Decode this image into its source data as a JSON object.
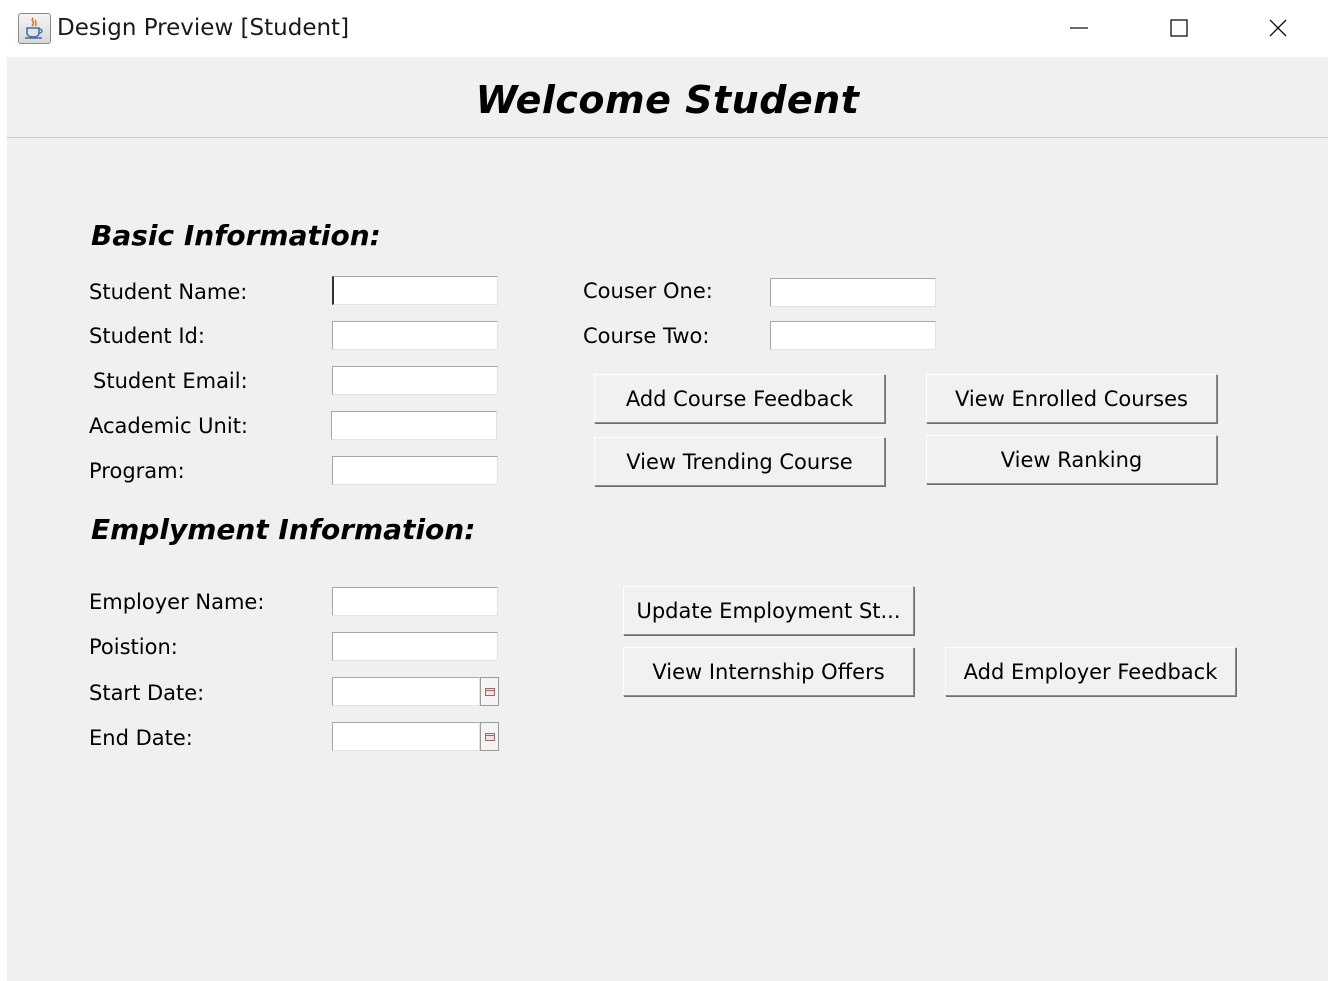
{
  "window": {
    "title": "Design Preview [Student]",
    "icon": "java-cup-icon",
    "controls": [
      "minimize-icon",
      "maximize-icon",
      "close-icon"
    ]
  },
  "heading": "Welcome Student",
  "basic_info": {
    "title": "Basic Information:",
    "fields": [
      {
        "label": "Student Name:",
        "value": ""
      },
      {
        "label": "Student Id:",
        "value": ""
      },
      {
        "label": "Student Email:",
        "value": ""
      },
      {
        "label": "Academic Unit:",
        "value": ""
      },
      {
        "label": "Program:",
        "value": ""
      }
    ],
    "courses": [
      {
        "label": "Couser One:",
        "value": ""
      },
      {
        "label": "Course Two:",
        "value": ""
      }
    ],
    "buttons": {
      "add_course_feedback": "Add Course Feedback",
      "view_enrolled_courses": "View Enrolled Courses",
      "view_trending_course": "View Trending Course",
      "view_ranking": "View Ranking"
    }
  },
  "employment_info": {
    "title": "Emplyment Information:",
    "fields": [
      {
        "label": "Employer Name:",
        "value": ""
      },
      {
        "label": "Poistion:",
        "value": ""
      },
      {
        "label": "Start Date:",
        "value": ""
      },
      {
        "label": "End Date:",
        "value": ""
      }
    ],
    "buttons": {
      "update_employment_status": "Update Employment St...",
      "view_internship_offers": "View Internship Offers",
      "add_employer_feedback": "Add Employer Feedback"
    }
  }
}
